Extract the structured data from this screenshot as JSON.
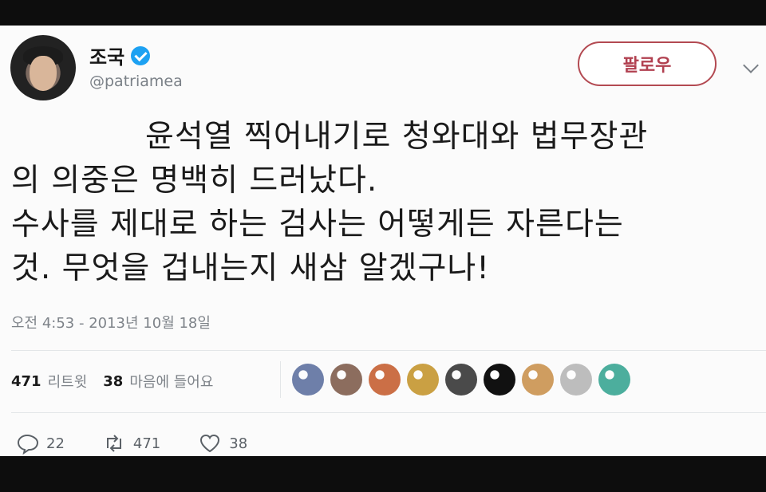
{
  "profile": {
    "name": "조국",
    "handle": "@patriamea",
    "follow_label": "팔로우"
  },
  "tweet": {
    "lines": [
      "윤석열 찍어내기로 청와대와 법무장관",
      "의 의중은 명백히 드러났다.",
      "수사를 제대로 하는 검사는 어떻게든 자른다는",
      "것. 무엇을 겁내는지 새삼 알겠구나!"
    ],
    "timestamp": "오전 4:53 - 2013년 10월 18일"
  },
  "stats": {
    "retweets": "471",
    "retweets_label": "리트윗",
    "likes": "38",
    "likes_label": "마음에 들어요"
  },
  "likers": [
    {
      "color": "#6e7fa9"
    },
    {
      "color": "#8c6d5e"
    },
    {
      "color": "#cb6f46"
    },
    {
      "color": "#caa043"
    },
    {
      "color": "#4a4a4a"
    },
    {
      "color": "#111111"
    },
    {
      "color": "#cf9d60"
    },
    {
      "color": "#bdbdbd"
    },
    {
      "color": "#4cae9d"
    }
  ],
  "actions": {
    "reply_count": "22",
    "retweet_count": "471",
    "like_count": "38"
  },
  "icons": {
    "verified": "verified-badge-icon",
    "more": "chevron-down-icon",
    "reply": "reply-icon",
    "retweet": "retweet-icon",
    "like": "heart-icon"
  },
  "colors": {
    "accent": "#1da1f2",
    "follow_border": "#b34a52"
  }
}
